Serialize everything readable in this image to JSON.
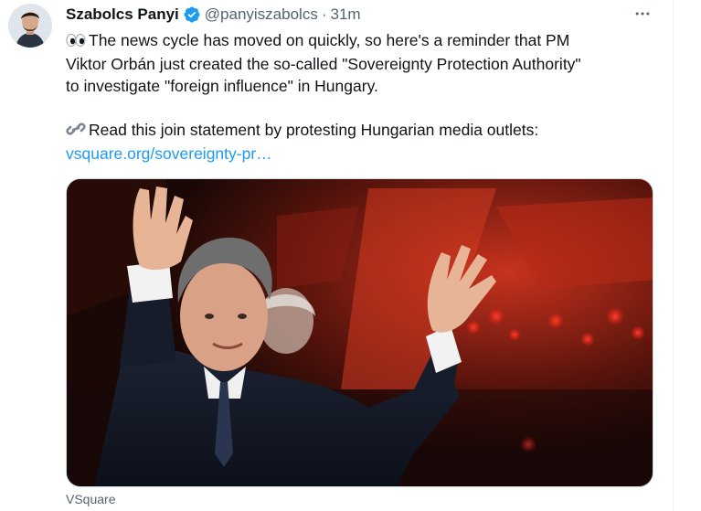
{
  "tweet": {
    "author_name": "Szabolcs Panyi",
    "handle": "@panyiszabolcs",
    "separator": "·",
    "time": "31m",
    "text_line_1": "The news cycle has moved on quickly, so here's a reminder that PM",
    "text_line_2": "Viktor Orbán just created the so-called \"Sovereignty Protection Authority\"",
    "text_line_3": "to investigate \"foreign influence\" in Hungary.",
    "text_line_4": "Read this join statement by protesting Hungarian media outlets:",
    "link": "vsquare.org/sovereignty-pr…",
    "card_source": "VSquare"
  },
  "icons": {
    "verified": "verified-badge-icon",
    "more": "more-options-icon",
    "eyes": "eyes-emoji-icon",
    "link": "link-emoji-icon"
  },
  "colors": {
    "accent": "#1d9bf0",
    "text": "#0f1419",
    "secondary": "#536471"
  }
}
